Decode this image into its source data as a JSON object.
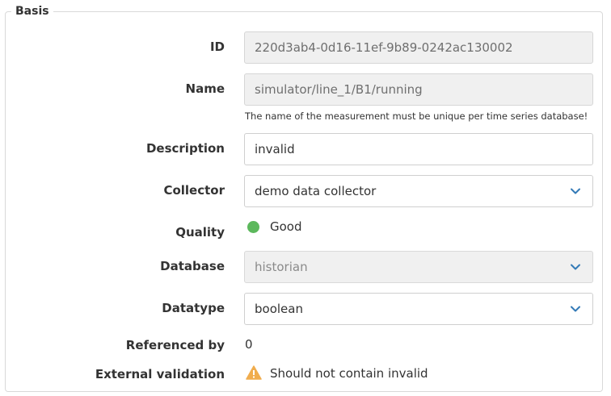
{
  "section": {
    "legend": "Basis"
  },
  "fields": {
    "id": {
      "label": "ID",
      "value": "220d3ab4-0d16-11ef-9b89-0242ac130002"
    },
    "name": {
      "label": "Name",
      "value": "simulator/line_1/B1/running",
      "help": "The name of the measurement must be unique per time series database!"
    },
    "description": {
      "label": "Description",
      "value": "invalid"
    },
    "collector": {
      "label": "Collector",
      "value": "demo data collector"
    },
    "quality": {
      "label": "Quality",
      "value": "Good",
      "color": "#5cb85c"
    },
    "database": {
      "label": "Database",
      "value": "historian"
    },
    "datatype": {
      "label": "Datatype",
      "value": "boolean"
    },
    "referenced_by": {
      "label": "Referenced by",
      "value": "0"
    },
    "external_validation": {
      "label": "External validation",
      "value": "Should not contain invalid",
      "icon_color": "#f0ad4e"
    }
  },
  "colors": {
    "chevron": "#337ab7"
  }
}
